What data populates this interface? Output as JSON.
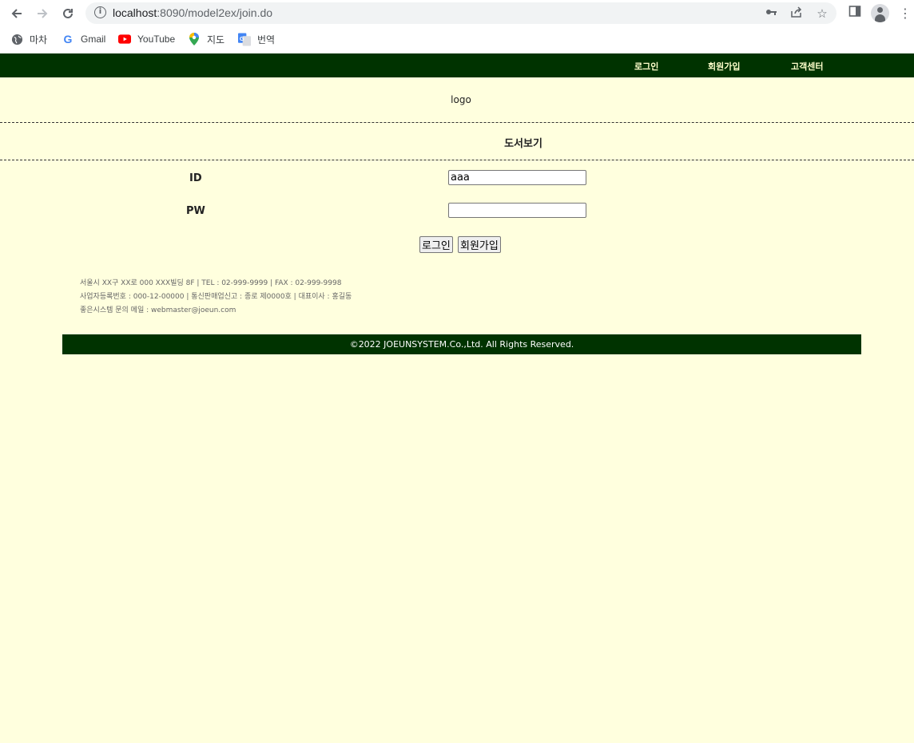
{
  "browser": {
    "url_host": "localhost",
    "url_rest": ":8090/model2ex/join.do",
    "bookmarks": [
      {
        "label": "마차",
        "icon": "globe-icon"
      },
      {
        "label": "Gmail",
        "icon": "google-icon"
      },
      {
        "label": "YouTube",
        "icon": "youtube-icon"
      },
      {
        "label": "지도",
        "icon": "maps-pin-icon"
      },
      {
        "label": "번역",
        "icon": "translate-icon"
      }
    ]
  },
  "topnav": {
    "login": "로그인",
    "join": "회원가입",
    "support": "고객센터"
  },
  "header": {
    "logo": "logo",
    "section_title": "도서보기"
  },
  "form": {
    "id_label": "ID",
    "id_value": "aaa",
    "pw_label": "PW",
    "pw_value": "",
    "login_button": "로그인",
    "join_button": "회원가입"
  },
  "company_info": {
    "line1": "서울시 XX구 XX로 000 XXX빌딩 8F | TEL : 02-999-9999 | FAX : 02-999-9998",
    "line2": "사업자등록번호 : 000-12-00000 | 통신판매업신고 : 종로 제0000호 | 대표이사 : 홍길동",
    "line3": "좋은시스템 문의 메일 : webmaster@joeun.com"
  },
  "footer": {
    "copyright": "©2022 JOEUNSYSTEM.Co.,Ltd. All Rights Reserved."
  },
  "colors": {
    "page_bg": "#ffffde",
    "nav_bg": "#003300",
    "nav_text": "#ffffcc"
  }
}
